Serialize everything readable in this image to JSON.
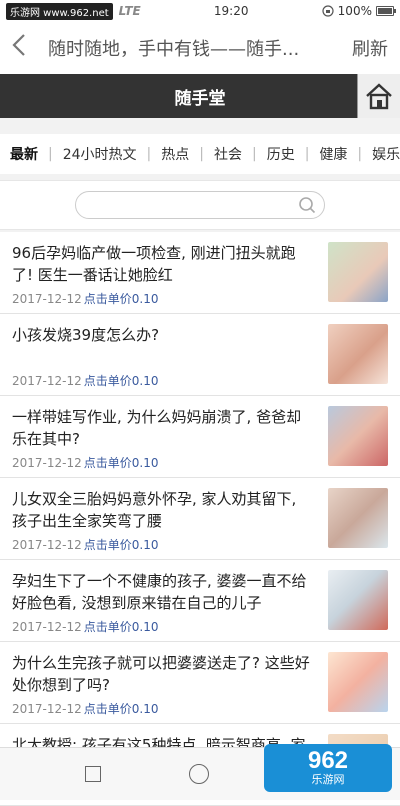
{
  "status": {
    "watermark": "乐游网 www.962.net",
    "signal": "LTE",
    "time": "19:20",
    "battery": "100%",
    "battery_level": 1.0
  },
  "appbar": {
    "back_icon": "chevron-left-icon",
    "title": "随时随地，手中有钱——随手...",
    "refresh_label": "刷新"
  },
  "banner": {
    "title": "随手堂",
    "home_icon": "home-icon"
  },
  "tabs": [
    "最新",
    "24小时热文",
    "热点",
    "社会",
    "历史",
    "健康",
    "娱乐"
  ],
  "search": {
    "placeholder": "",
    "icon": "search-icon"
  },
  "articles": [
    {
      "title": "96后孕妈临产做一项检查, 刚进门扭头就跑了! 医生一番话让她脸红",
      "date": "2017-12-12",
      "price": "点击单价0.10"
    },
    {
      "title": "小孩发烧39度怎么办?",
      "date": "2017-12-12",
      "price": "点击单价0.10"
    },
    {
      "title": "一样带娃写作业, 为什么妈妈崩溃了, 爸爸却乐在其中?",
      "date": "2017-12-12",
      "price": "点击单价0.10"
    },
    {
      "title": "儿女双全三胎妈妈意外怀孕, 家人劝其留下, 孩子出生全家笑弯了腰",
      "date": "2017-12-12",
      "price": "点击单价0.10"
    },
    {
      "title": "孕妇生下了一个不健康的孩子, 婆婆一直不给好脸色看, 没想到原来错在自己的儿子",
      "date": "2017-12-12",
      "price": "点击单价0.10"
    },
    {
      "title": "为什么生完孩子就可以把婆婆送走了? 这些好处你想到了吗?",
      "date": "2017-12-12",
      "price": "点击单价0.10"
    },
    {
      "title": "北大教授: 孩子有这5种特点, 暗示智商高, 家",
      "date": "",
      "price": ""
    }
  ],
  "brand": {
    "logo_text": "962",
    "logo_sub": "乐游网"
  },
  "colors": {
    "banner": "#333333",
    "price": "#3a5a9e",
    "logo": "#1a8fd6"
  }
}
